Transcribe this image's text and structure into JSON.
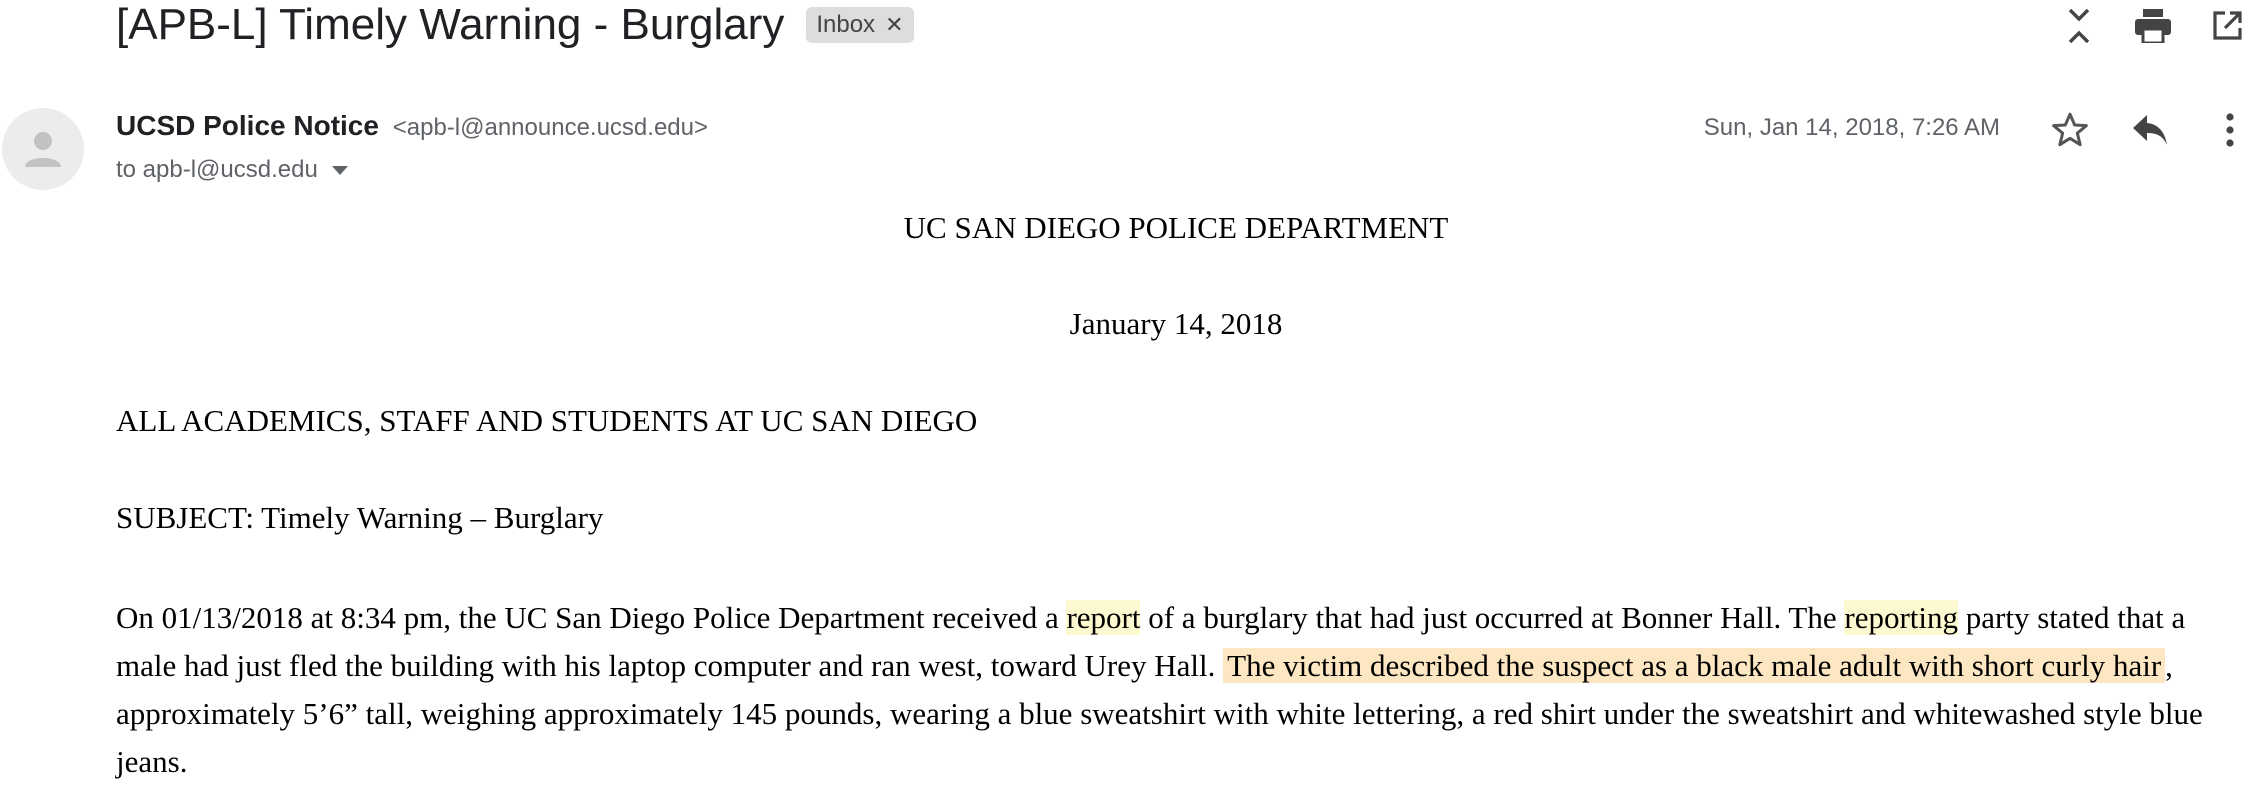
{
  "email": {
    "subject": "[APB-L] Timely Warning - Burglary",
    "label": "Inbox",
    "sender_name": "UCSD Police Notice",
    "sender_email": "<apb-l@announce.ucsd.edu>",
    "to": "to apb-l@ucsd.edu",
    "date": "Sun, Jan 14, 2018, 7:26 AM"
  },
  "icons": {
    "label_remove": "close-icon",
    "collapse": "collapse-all-icon",
    "print": "print-icon",
    "open_new_window": "open-in-new-window-icon",
    "avatar": "person-icon",
    "star": "star-icon",
    "reply": "reply-icon",
    "more": "more-vert-icon",
    "to_dropdown": "caret-down-icon"
  },
  "body": {
    "department": "UC SAN DIEGO POLICE DEPARTMENT",
    "date": "January 14, 2018",
    "audience": "ALL ACADEMICS, STAFF AND STUDENTS AT UC SAN DIEGO",
    "subject_line": "SUBJECT: Timely Warning – Burglary",
    "paragraph": {
      "p1": "On 01/13/2018 at 8:34 pm, the UC San Diego Police Department received a ",
      "p2": "report",
      "p3": " of a burglary that had just occurred at Bonner Hall.  The ",
      "p4": "reporting",
      "p5": " party stated that a male had just fled the building with his laptop computer and ran west, toward Urey Hall.  ",
      "p6": "The victim described the suspect as a black male adult with short curly hair",
      "p7": ", approximately 5’6” tall, weighing approximately 145 pounds, wearing a blue sweatshirt with white lettering, a red shirt under the sweatshirt and whitewashed style blue jeans."
    }
  },
  "colors": {
    "highlight_yellow": "#fcf8cf",
    "highlight_orange": "#fde7c2",
    "label_chip": "#dddddd"
  }
}
